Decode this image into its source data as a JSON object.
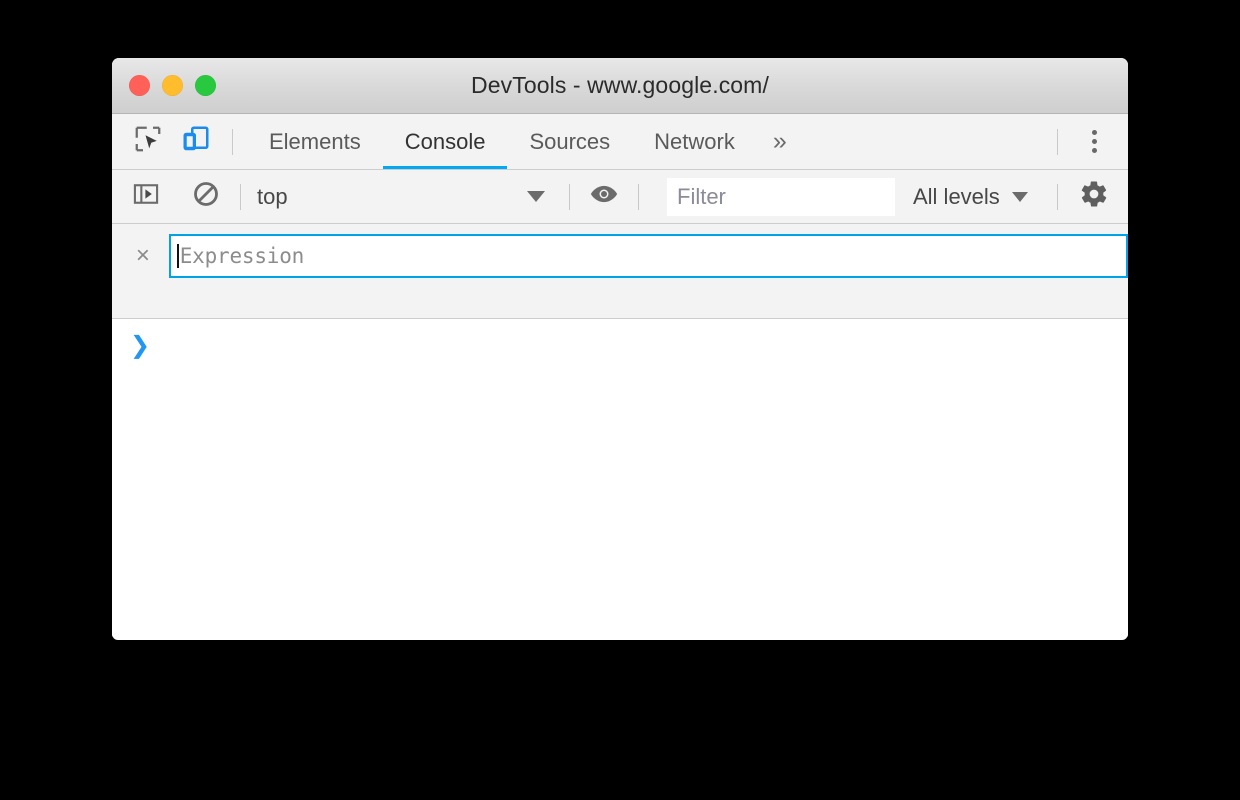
{
  "window": {
    "title": "DevTools - www.google.com/",
    "traffic_lights": [
      {
        "name": "close",
        "color": "#ff6058"
      },
      {
        "name": "minimize",
        "color": "#ffbd2e"
      },
      {
        "name": "zoom",
        "color": "#28c83f"
      }
    ]
  },
  "tabstrip": {
    "inspect_icon": "inspect-element-icon",
    "device_icon": "device-toolbar-icon",
    "device_icon_color": "#1a8cf0",
    "tabs": [
      {
        "label": "Elements",
        "active": false
      },
      {
        "label": "Console",
        "active": true
      },
      {
        "label": "Sources",
        "active": false
      },
      {
        "label": "Network",
        "active": false
      }
    ],
    "more_tabs_label": "»",
    "menu_icon": "more-vertical-icon",
    "active_underline_color": "#03a9f4"
  },
  "console_toolbar": {
    "sidebar_icon": "console-sidebar-icon",
    "clear_icon": "clear-console-icon",
    "context": {
      "value": "top",
      "caret": "▼"
    },
    "live_expression_icon": "eye-icon",
    "filter": {
      "value": "",
      "placeholder": "Filter"
    },
    "levels": {
      "value": "All levels",
      "caret": "▼"
    },
    "settings_icon": "gear-icon"
  },
  "live_expression": {
    "close_label": "×",
    "value": "",
    "placeholder": "Expression",
    "focus_border_color": "#00a2e8"
  },
  "console_output": {
    "prompt_symbol": "❯",
    "prompt_color": "#2196f3",
    "entries": []
  }
}
